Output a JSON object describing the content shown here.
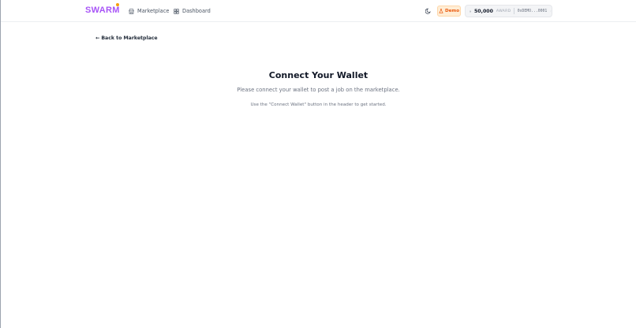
{
  "header": {
    "logo": "SWARM",
    "nav": [
      {
        "label": "Marketplace",
        "icon": "store-icon"
      },
      {
        "label": "Dashboard",
        "icon": "grid-icon"
      }
    ],
    "theme_icon": "moon-icon",
    "demo_badge": "Demo",
    "wallet": {
      "balance": "50,000",
      "token": "AWARD",
      "address": "0xDEMO...0001"
    }
  },
  "main": {
    "back_link": "← Back to Marketplace",
    "title": "Connect Your Wallet",
    "subtitle": "Please connect your wallet to post a job on the marketplace.",
    "hint": "Use the \"Connect Wallet\" button in the header to get started."
  },
  "colors": {
    "brand": "#a855f7",
    "demo_bg": "#ffedd5",
    "demo_text": "#ea580c"
  }
}
